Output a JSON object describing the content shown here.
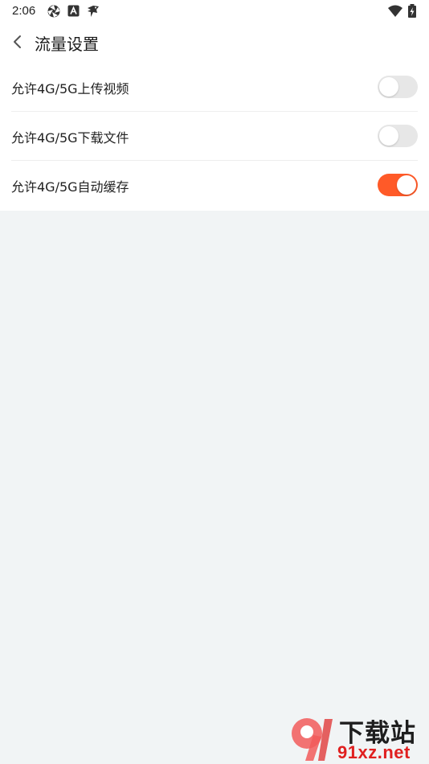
{
  "status_bar": {
    "time": "2:06",
    "icons": [
      "aperture-icon",
      "a-square-icon",
      "bird-icon",
      "wifi-icon",
      "battery-icon"
    ]
  },
  "header": {
    "title": "流量设置",
    "back_icon": "chevron-left-icon"
  },
  "settings": [
    {
      "label": "允许4G/5G上传视频",
      "enabled": false
    },
    {
      "label": "允许4G/5G下载文件",
      "enabled": false
    },
    {
      "label": "允许4G/5G自动缓存",
      "enabled": true
    }
  ],
  "colors": {
    "accent": "#ff5a28",
    "page_background": "#f1f4f5",
    "toggle_off": "#e7e7e7"
  },
  "watermark": {
    "line1": "下载站",
    "line2": "91xz.net",
    "logo": "91"
  }
}
